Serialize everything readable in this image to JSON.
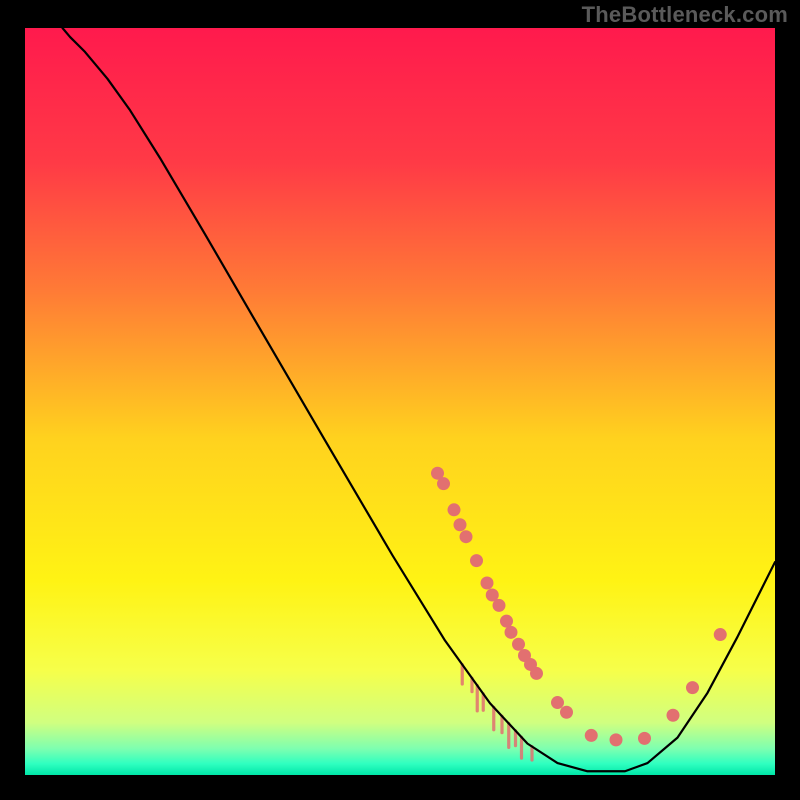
{
  "attribution": "TheBottleneck.com",
  "chart_data": {
    "type": "line",
    "title": "",
    "xlabel": "",
    "ylabel": "",
    "xlim": [
      0,
      100
    ],
    "ylim": [
      0,
      100
    ],
    "background_gradient": {
      "stops": [
        {
          "offset": 0.0,
          "color": "#ff1a4d"
        },
        {
          "offset": 0.18,
          "color": "#ff3a46"
        },
        {
          "offset": 0.35,
          "color": "#ff7a36"
        },
        {
          "offset": 0.55,
          "color": "#ffd21e"
        },
        {
          "offset": 0.74,
          "color": "#fff314"
        },
        {
          "offset": 0.86,
          "color": "#f6ff4a"
        },
        {
          "offset": 0.93,
          "color": "#d0ff80"
        },
        {
          "offset": 0.965,
          "color": "#7dffb0"
        },
        {
          "offset": 0.985,
          "color": "#2fffc0"
        },
        {
          "offset": 1.0,
          "color": "#00e6a8"
        }
      ]
    },
    "curve": [
      {
        "x": 5.0,
        "y": 100.0
      },
      {
        "x": 6.0,
        "y": 98.8
      },
      {
        "x": 8.0,
        "y": 96.8
      },
      {
        "x": 11.0,
        "y": 93.2
      },
      {
        "x": 14.0,
        "y": 89.0
      },
      {
        "x": 18.0,
        "y": 82.6
      },
      {
        "x": 24.0,
        "y": 72.4
      },
      {
        "x": 31.0,
        "y": 60.3
      },
      {
        "x": 40.0,
        "y": 44.8
      },
      {
        "x": 49.0,
        "y": 29.4
      },
      {
        "x": 56.0,
        "y": 18.0
      },
      {
        "x": 62.0,
        "y": 9.6
      },
      {
        "x": 67.0,
        "y": 4.2
      },
      {
        "x": 71.0,
        "y": 1.6
      },
      {
        "x": 75.0,
        "y": 0.5
      },
      {
        "x": 80.0,
        "y": 0.5
      },
      {
        "x": 83.0,
        "y": 1.6
      },
      {
        "x": 87.0,
        "y": 5.0
      },
      {
        "x": 91.0,
        "y": 11.0
      },
      {
        "x": 95.0,
        "y": 18.5
      },
      {
        "x": 98.5,
        "y": 25.5
      },
      {
        "x": 100.0,
        "y": 28.5
      }
    ],
    "markers": [
      {
        "x": 55.0,
        "y": 40.4
      },
      {
        "x": 55.8,
        "y": 39.0
      },
      {
        "x": 57.2,
        "y": 35.5
      },
      {
        "x": 58.0,
        "y": 33.5
      },
      {
        "x": 58.8,
        "y": 31.9
      },
      {
        "x": 60.2,
        "y": 28.7
      },
      {
        "x": 61.6,
        "y": 25.7
      },
      {
        "x": 62.3,
        "y": 24.1
      },
      {
        "x": 63.2,
        "y": 22.7
      },
      {
        "x": 64.2,
        "y": 20.6
      },
      {
        "x": 64.8,
        "y": 19.1
      },
      {
        "x": 65.8,
        "y": 17.5
      },
      {
        "x": 66.6,
        "y": 16.0
      },
      {
        "x": 67.4,
        "y": 14.8
      },
      {
        "x": 68.2,
        "y": 13.6
      },
      {
        "x": 71.0,
        "y": 9.7
      },
      {
        "x": 72.2,
        "y": 8.4
      },
      {
        "x": 75.5,
        "y": 5.3
      },
      {
        "x": 78.8,
        "y": 4.7
      },
      {
        "x": 82.6,
        "y": 4.9
      },
      {
        "x": 86.4,
        "y": 8.0
      },
      {
        "x": 89.0,
        "y": 11.7
      },
      {
        "x": 92.7,
        "y": 18.8
      }
    ],
    "drips": [
      {
        "x": 58.3,
        "len": 2.6
      },
      {
        "x": 59.6,
        "len": 1.8
      },
      {
        "x": 60.3,
        "len": 3.4
      },
      {
        "x": 61.1,
        "len": 2.2
      },
      {
        "x": 62.5,
        "len": 3.0
      },
      {
        "x": 63.6,
        "len": 2.2
      },
      {
        "x": 64.5,
        "len": 3.2
      },
      {
        "x": 65.4,
        "len": 2.0
      },
      {
        "x": 66.2,
        "len": 2.8
      },
      {
        "x": 67.6,
        "len": 1.8
      }
    ],
    "marker_color": "#e27070",
    "marker_radius": 6.5,
    "line_color": "#000000",
    "line_width": 2.2
  }
}
